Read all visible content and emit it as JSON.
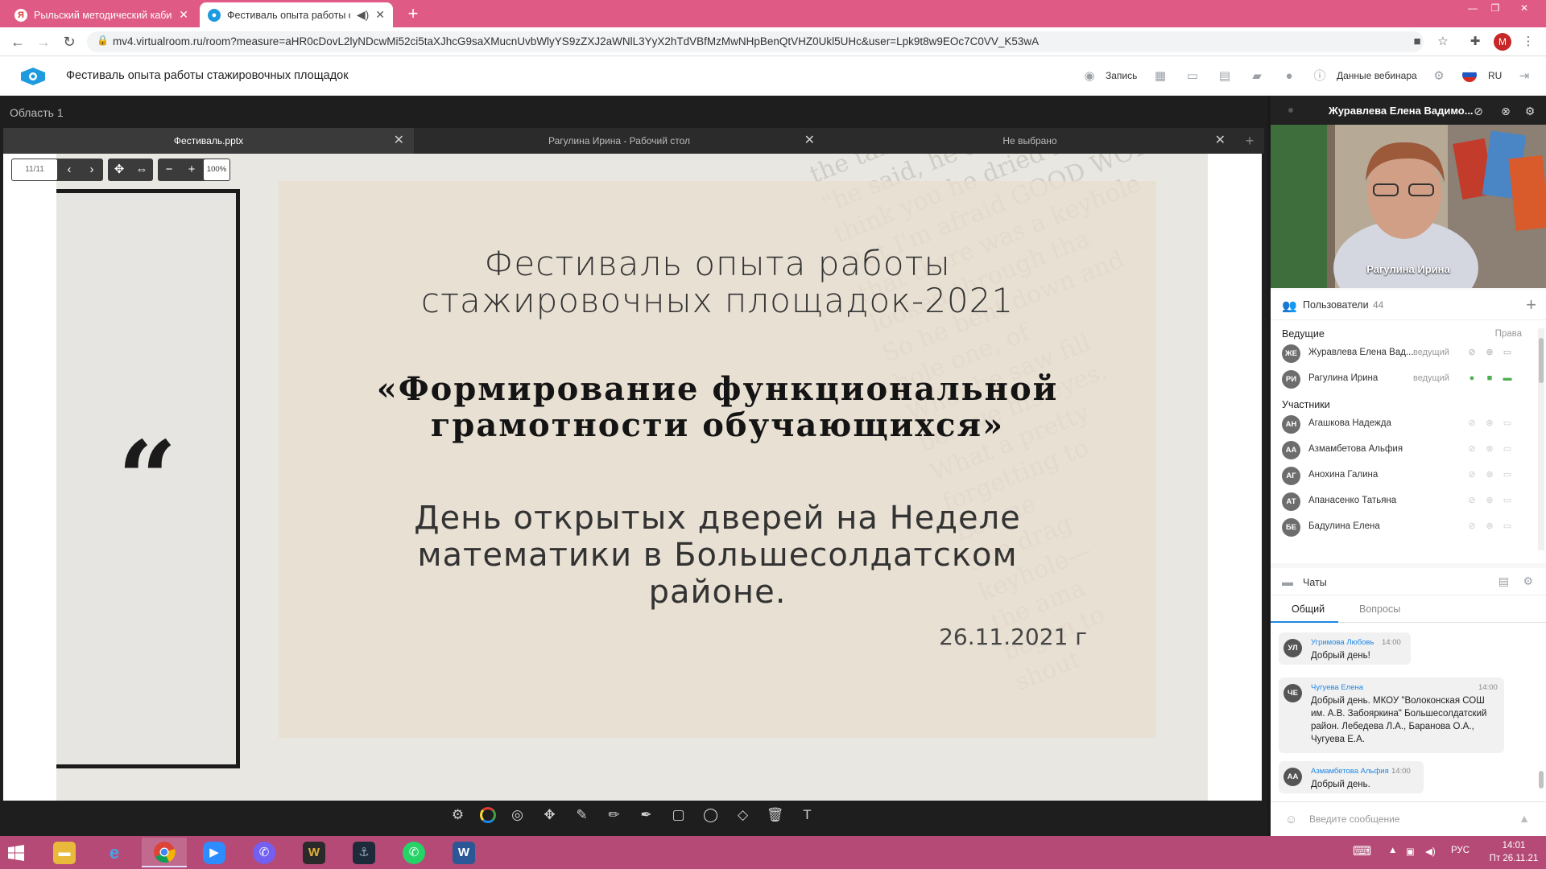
{
  "browser": {
    "tabs": [
      {
        "label": "Рыльский методический кабинет",
        "favicon": "Я",
        "active": false
      },
      {
        "label": "Фестиваль опыта работы стажировочных площадок",
        "favicon": "",
        "active": true
      }
    ],
    "url": "mv4.virtualroom.ru/room?measure=aHR0cDovL2lyNDcwMi52ci5taXJhcG9saXMucnUvbWlyYS9zZXJ2aWNlL3YyX2hTdVBfMzMwNHpBenQtVHZ0Ukl5UHc&user=Lpk9t8w9EOc7C0VV_K53wA",
    "profile_initial": "M"
  },
  "app": {
    "title": "Фестиваль опыта работы стажировочных площадок",
    "record_label": "Запись",
    "webinar_data_label": "Данные вебинара",
    "language": "RU"
  },
  "workspace": {
    "area_label": "Область 1",
    "doc_tabs": [
      {
        "label": "Фестиваль.pptx",
        "active": true
      },
      {
        "label": "Рагулина Ирина - Рабочий стол",
        "active": false
      },
      {
        "label": "Не выбрано",
        "active": false
      }
    ],
    "page_indicator": "11/11",
    "zoom": "100%"
  },
  "slide": {
    "title_line1": "Фестиваль опыта работы",
    "title_line2": "стажировочных площадок-2021",
    "theme_line1": "«Формирование функциональной",
    "theme_line2": "грамотности обучающихся»",
    "sub_line1": "День открытых дверей на Неделе",
    "sub_line2": "математики в Большесолдатском",
    "sub_line3": "районе.",
    "date": "26.11.2021 г",
    "bg_text": [
      "the table.\" So late tha",
      "\"he said, he'd be punctua",
      "think you he dried her eyes",
      "But I'm afraid GOOD WORK SE",
      "that there was a keyhole",
      "looked through tha",
      "So he bent down and",
      "hole one, of",
      "What he saw fill",
      "believe his eyes.",
      "What a pretty",
      "forgetting to",
      "Let me",
      "She drag",
      "keyhole—",
      "the ama",
      "began to",
      "shout"
    ]
  },
  "video": {
    "header_name": "Журавлева Елена Вадимо...",
    "speaker_label": "Рагулина Ирина"
  },
  "users": {
    "label": "Пользователи",
    "count": "44",
    "hosts_label": "Ведущие",
    "rights_label": "Права",
    "participants_label": "Участники",
    "hosts": [
      {
        "initials": "ЖЕ",
        "name": "Журавлева Елена Вад...",
        "role": "ведущий"
      },
      {
        "initials": "РИ",
        "name": "Рагулина Ирина",
        "role": "ведущий"
      }
    ],
    "participants": [
      {
        "initials": "АН",
        "name": "Агашкова Надежда"
      },
      {
        "initials": "АА",
        "name": "Азмамбетова Альфия"
      },
      {
        "initials": "АГ",
        "name": "Анохина Галина"
      },
      {
        "initials": "АТ",
        "name": "Апанасенко Татьяна"
      },
      {
        "initials": "БЕ",
        "name": "Бадулина Елена"
      }
    ]
  },
  "chats": {
    "label": "Чаты",
    "tab_general": "Общий",
    "tab_questions": "Вопросы",
    "messages": [
      {
        "initials": "УЛ",
        "author": "Угримова Любовь",
        "time": "14:00",
        "text": "Добрый день!"
      },
      {
        "initials": "ЧЕ",
        "author": "Чугуева Елена",
        "time": "14:00",
        "text": "Добрый день. МКОУ \"Волоконская СОШ им. А.В. Забояркина\" Большесолдатский район. Лебедева Л.А., Баранова О.А., Чугуева Е.А."
      },
      {
        "initials": "АА",
        "author": "Азмамбетова Альфия",
        "time": "14:00",
        "text": "Добрый день."
      }
    ],
    "input_placeholder": "Введите сообщение"
  },
  "taskbar": {
    "language": "РУС",
    "time": "14:01",
    "date": "Пт 26.11.21"
  }
}
